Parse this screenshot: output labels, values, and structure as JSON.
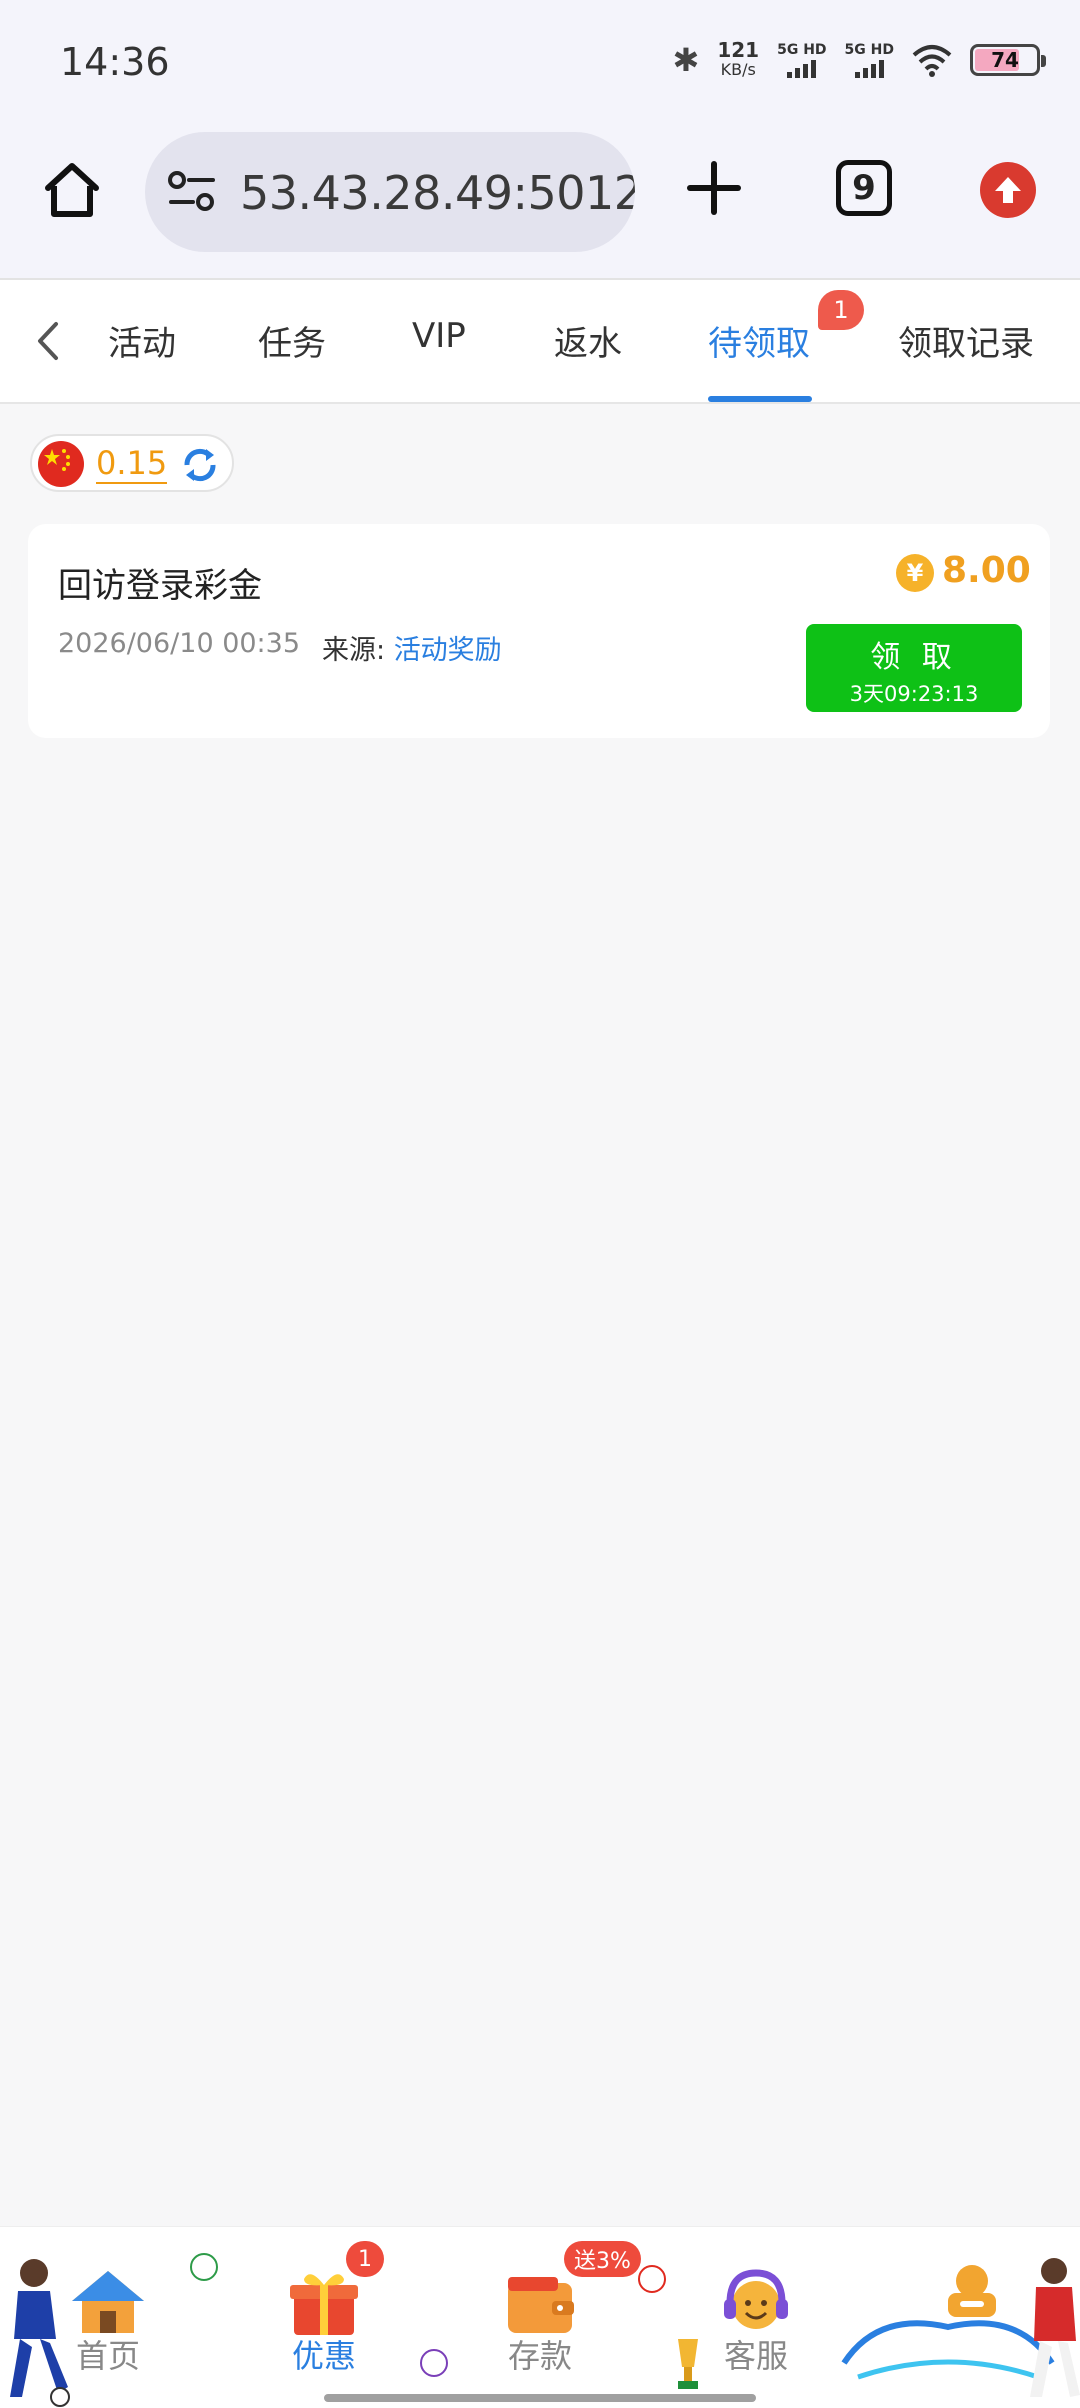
{
  "status_bar": {
    "time": "14:36",
    "net_speed_value": "121",
    "net_speed_unit": "KB/s",
    "sim1_label": "5G HD",
    "sim2_label": "5G HD",
    "battery_level": "74",
    "icons": [
      "bluetooth-icon",
      "signal-icon",
      "wifi-icon",
      "battery-icon"
    ]
  },
  "browser": {
    "url": "53.43.28.49:5012",
    "tab_count": "9",
    "icons": [
      "home-icon",
      "site-settings-icon",
      "new-tab-icon",
      "tabs-icon",
      "update-icon"
    ]
  },
  "tabs": {
    "items": [
      {
        "label": "活动"
      },
      {
        "label": "任务"
      },
      {
        "label": "VIP"
      },
      {
        "label": "返水"
      },
      {
        "label": "待领取",
        "active": true,
        "badge": "1"
      },
      {
        "label": "领取记录"
      }
    ]
  },
  "balance": {
    "value": "0.15"
  },
  "reward": {
    "title": "回访登录彩金",
    "datetime": "2026/06/10 00:35",
    "source_label": "来源: ",
    "source_value": "活动奖励",
    "amount": "8.00",
    "currency_symbol": "¥",
    "claim_label": "领 取",
    "countdown": "3天09:23:13"
  },
  "bottom_nav": {
    "items": [
      {
        "label": "首页"
      },
      {
        "label": "优惠",
        "active": true,
        "badge": "1"
      },
      {
        "label": "存款",
        "badge": "送3%"
      },
      {
        "label": "客服"
      }
    ]
  },
  "colors": {
    "accent": "#2a7fe0",
    "claim_green": "#0ec116",
    "amount_orange": "#f0a020",
    "badge_red": "#ee5a4c"
  }
}
